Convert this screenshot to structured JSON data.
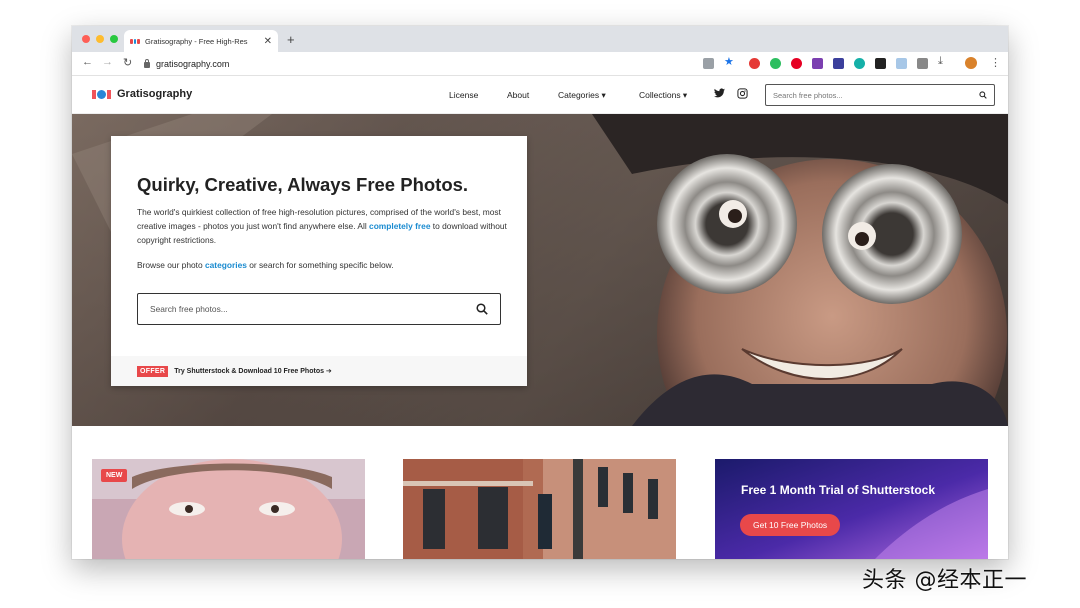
{
  "browser": {
    "tab_title": "Gratisography - Free High-Res",
    "url": "gratisography.com"
  },
  "header": {
    "logo_text": "Gratisography",
    "menu": [
      "License",
      "About",
      "Categories ▾",
      "Collections ▾"
    ],
    "search_placeholder": "Search free photos..."
  },
  "hero": {
    "title": "Quirky, Creative, Always Free Photos.",
    "desc_before": "The world's quirkiest collection of free high-resolution pictures, comprised of the world's best, most creative images - photos you just won't find anywhere else. All ",
    "desc_link": "completely free",
    "desc_after": " to download without copyright restrictions.",
    "browse_before": "Browse our photo ",
    "browse_link": "categories",
    "browse_after": " or search for something specific below.",
    "search_placeholder": "Search free photos...",
    "offer_badge": "OFFER",
    "offer_text": "Try Shutterstock & Download 10 Free Photos ➔"
  },
  "tiles": {
    "new_badge": "NEW",
    "promo_title": "Free 1 Month Trial of Shutterstock",
    "promo_button": "Get 10 Free Photos"
  },
  "watermark": "头条 @经本正一",
  "colors": {
    "accent": "#e8484a",
    "link": "#1a8bd0",
    "logo_blue": "#2a86d6"
  }
}
